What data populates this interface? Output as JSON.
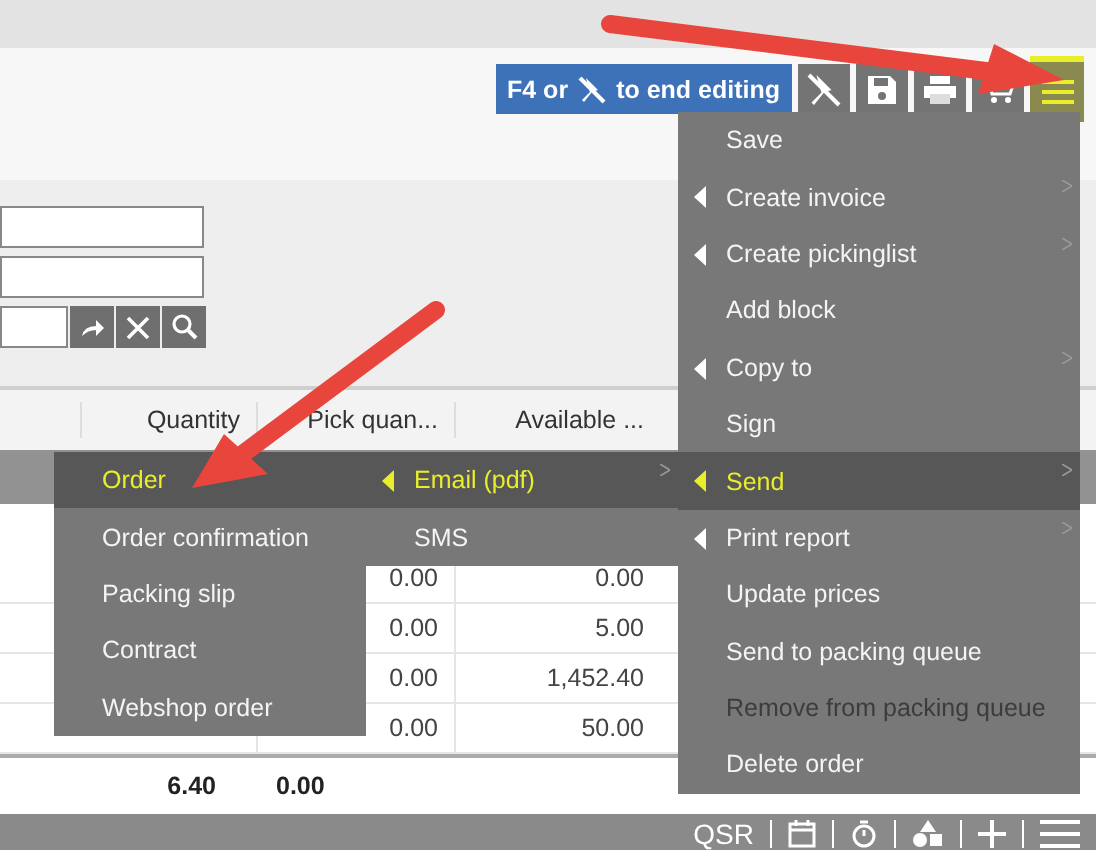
{
  "toolbar": {
    "banner": {
      "before": "F4 or",
      "after": "to end editing"
    }
  },
  "table": {
    "columns": [
      "Quantity",
      "Pick quan...",
      "Available ..."
    ],
    "rows": [
      {
        "pick": "0.00",
        "available": "0.00"
      },
      {
        "pick": "0.00",
        "available": "5.00"
      },
      {
        "pick": "0.00",
        "available": "1,452.40"
      },
      {
        "pick": "0.00",
        "available": "50.00"
      }
    ],
    "totals": {
      "quantity": "6.40",
      "pick": "0.00"
    }
  },
  "menu": {
    "items": [
      {
        "label": "Save",
        "submenu": false,
        "selected": false,
        "disabled": false
      },
      {
        "label": "Create invoice",
        "submenu": true,
        "selected": false,
        "disabled": false
      },
      {
        "label": "Create pickinglist",
        "submenu": true,
        "selected": false,
        "disabled": false
      },
      {
        "label": "Add block",
        "submenu": false,
        "selected": false,
        "disabled": false
      },
      {
        "label": "Copy to",
        "submenu": true,
        "selected": false,
        "disabled": false
      },
      {
        "label": "Sign",
        "submenu": false,
        "selected": false,
        "disabled": false
      },
      {
        "label": "Send",
        "submenu": true,
        "selected": true,
        "disabled": false
      },
      {
        "label": "Print report",
        "submenu": true,
        "selected": false,
        "disabled": false
      },
      {
        "label": "Update prices",
        "submenu": false,
        "selected": false,
        "disabled": false
      },
      {
        "label": "Send to packing queue",
        "submenu": false,
        "selected": false,
        "disabled": false
      },
      {
        "label": "Remove from packing queue",
        "submenu": false,
        "selected": false,
        "disabled": true
      },
      {
        "label": "Delete order",
        "submenu": false,
        "selected": false,
        "disabled": false
      }
    ]
  },
  "send_submenu": {
    "items": [
      {
        "label": "Email (pdf)",
        "submenu": true,
        "selected": true,
        "disabled": false
      },
      {
        "label": "SMS",
        "submenu": false,
        "selected": false,
        "disabled": false
      }
    ]
  },
  "email_submenu": {
    "items": [
      {
        "label": "Order",
        "submenu": false,
        "selected": true,
        "disabled": false
      },
      {
        "label": "Order confirmation",
        "submenu": false,
        "selected": false,
        "disabled": false
      },
      {
        "label": "Packing slip",
        "submenu": false,
        "selected": false,
        "disabled": false
      },
      {
        "label": "Contract",
        "submenu": false,
        "selected": false,
        "disabled": false
      },
      {
        "label": "Webshop order",
        "submenu": false,
        "selected": false,
        "disabled": false
      }
    ]
  },
  "status_bar": {
    "label": "QSR"
  }
}
